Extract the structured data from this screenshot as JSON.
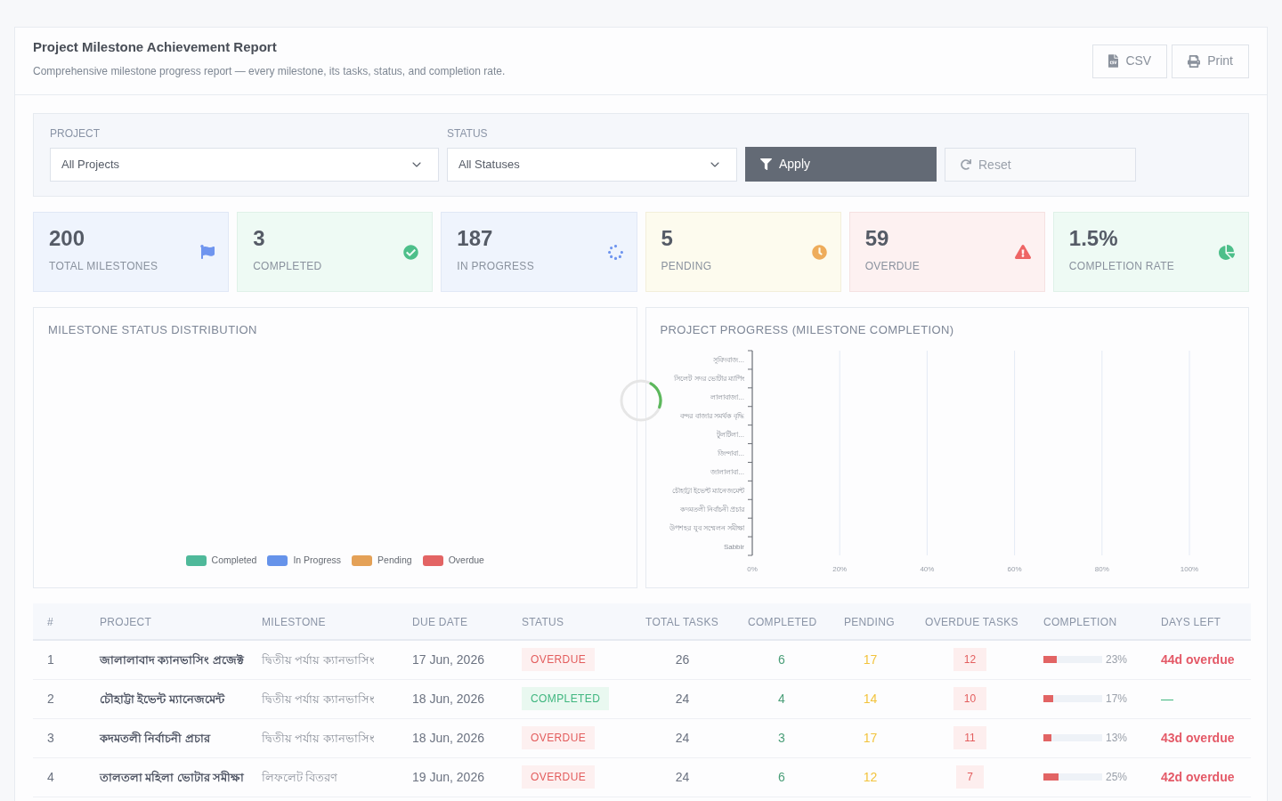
{
  "header": {
    "title": "Project Milestone Achievement Report",
    "subtitle": "Comprehensive milestone progress report — every milestone, its tasks, status, and completion rate.",
    "actions": [
      {
        "kind": "csv",
        "label": "CSV"
      },
      {
        "kind": "print",
        "label": "Print"
      }
    ]
  },
  "filters": {
    "fields": [
      {
        "label": "PROJECT",
        "value": "All Projects"
      },
      {
        "label": "STATUS",
        "value": "All Statuses"
      }
    ],
    "apply": "Apply",
    "reset": "Reset"
  },
  "stats": [
    {
      "kind": "total",
      "value": "200",
      "label": "TOTAL MILESTONES",
      "color": "#6f95ef"
    },
    {
      "kind": "completed",
      "value": "3",
      "label": "COMPLETED",
      "color": "#4dbf8a"
    },
    {
      "kind": "in_progress",
      "value": "187",
      "label": "IN PROGRESS",
      "color": "#6f95ef"
    },
    {
      "kind": "pending",
      "value": "5",
      "label": "PENDING",
      "color": "#eeac5b"
    },
    {
      "kind": "overdue",
      "value": "59",
      "label": "OVERDUE",
      "color": "#ee6565"
    },
    {
      "kind": "rate",
      "value": "1.5%",
      "label": "COMPLETION RATE",
      "color": "#4dbf8a"
    }
  ],
  "status_chart": {
    "title": "MILESTONE STATUS DISTRIBUTION",
    "legend": [
      {
        "label": "Completed",
        "color": "#4fb99a"
      },
      {
        "label": "In Progress",
        "color": "#6693ea"
      },
      {
        "label": "Pending",
        "color": "#e4a157"
      },
      {
        "label": "Overdue",
        "color": "#e36464"
      }
    ]
  },
  "progress_chart": {
    "title": "PROJECT PROGRESS (MILESTONE COMPLETION)",
    "chart_data": {
      "type": "bar",
      "orientation": "horizontal",
      "grid": true,
      "categories": [
        "সুবিদবাজ...",
        "সিলেট সদর ভোটার ম্যাপিং",
        "লালাবাজা...",
        "বন্দর বাজার সমর্থক বৃদ্ধি",
        "টুলটিলা...",
        "জিন্দাবা...",
        "জালালাবা...",
        "চৌহাট্টা ইভেন্ট ম্যানেজমেন্ট",
        "কদমতলী নির্বাচনী প্রচার",
        "উপশহর যুব সম্মেলন সমীক্ষা",
        "Sabbir"
      ],
      "values": [
        0,
        0,
        0,
        0,
        0,
        0,
        0,
        0,
        0,
        0,
        0
      ],
      "xlim": [
        0,
        100
      ],
      "xticks": [
        {
          "value": 0,
          "label": "0%"
        },
        {
          "value": 20,
          "label": "20%"
        },
        {
          "value": 40,
          "label": "40%"
        },
        {
          "value": 60,
          "label": "60%"
        },
        {
          "value": 80,
          "label": "80%"
        },
        {
          "value": 100,
          "label": "100%"
        }
      ]
    }
  },
  "table": {
    "columns": [
      "#",
      "PROJECT",
      "MILESTONE",
      "DUE DATE",
      "STATUS",
      "TOTAL TASKS",
      "COMPLETED",
      "PENDING",
      "OVERDUE TASKS",
      "COMPLETION",
      "DAYS LEFT"
    ],
    "rows": [
      {
        "index": "1",
        "project": "জালালাবাদ ক্যানভাসিং প্রজেক্ট",
        "milestone": "দ্বিতীয় পর্যায় ক্যানভাসিং",
        "due_date": "17 Jun, 2026",
        "status": {
          "kind": "overdue",
          "label": "OVERDUE"
        },
        "total_tasks": "26",
        "completed": "6",
        "pending": "17",
        "overdue_tasks": "12",
        "completion": {
          "level": 0.23,
          "label": "23%"
        },
        "days_left": "44d overdue"
      },
      {
        "index": "2",
        "project": "চৌহাট্টা ইভেন্ট ম্যানেজমেন্ট",
        "milestone": "দ্বিতীয় পর্যায় ক্যানভাসিং",
        "due_date": "18 Jun, 2026",
        "status": {
          "kind": "completed",
          "label": "COMPLETED"
        },
        "total_tasks": "24",
        "completed": "4",
        "pending": "14",
        "overdue_tasks": "10",
        "completion": {
          "level": 0.17,
          "label": "17%"
        },
        "days_left": "—"
      },
      {
        "index": "3",
        "project": "কদমতলী নির্বাচনী প্রচার",
        "milestone": "দ্বিতীয় পর্যায় ক্যানভাসিং",
        "due_date": "18 Jun, 2026",
        "status": {
          "kind": "overdue",
          "label": "OVERDUE"
        },
        "total_tasks": "24",
        "completed": "3",
        "pending": "17",
        "overdue_tasks": "11",
        "completion": {
          "level": 0.13,
          "label": "13%"
        },
        "days_left": "43d overdue"
      },
      {
        "index": "4",
        "project": "তালতলা মহিলা ভোটার সমীক্ষা",
        "milestone": "লিফলেট বিতরণ",
        "due_date": "19 Jun, 2026",
        "status": {
          "kind": "overdue",
          "label": "OVERDUE"
        },
        "total_tasks": "24",
        "completed": "6",
        "pending": "12",
        "overdue_tasks": "7",
        "completion": {
          "level": 0.25,
          "label": "25%"
        },
        "days_left": "42d overdue"
      }
    ]
  }
}
